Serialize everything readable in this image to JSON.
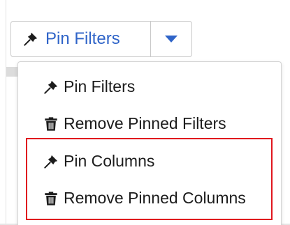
{
  "split_button": {
    "label": "Pin Filters",
    "icon": "pin-icon",
    "toggle_icon": "caret-down-icon",
    "accent_color": "#2f64c8"
  },
  "menu": {
    "items": [
      {
        "label": "Pin Filters",
        "icon": "pin-icon"
      },
      {
        "label": "Remove Pinned Filters",
        "icon": "trash-icon"
      },
      {
        "label": "Pin Columns",
        "icon": "pin-icon"
      },
      {
        "label": "Remove Pinned Columns",
        "icon": "trash-icon"
      }
    ]
  },
  "highlight": {
    "color": "#e0161e"
  }
}
